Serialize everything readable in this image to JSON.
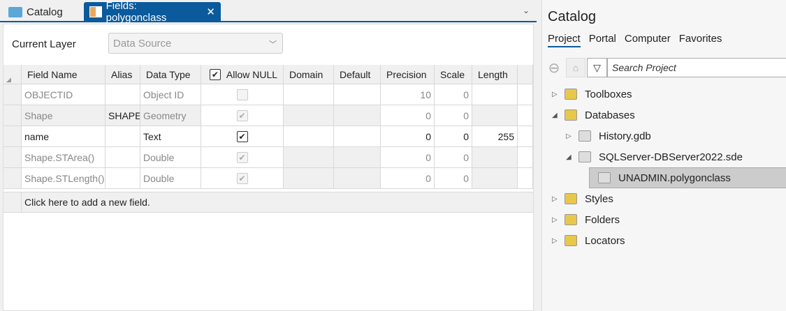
{
  "tabs": {
    "catalog": "Catalog",
    "fields": "Fields: polygonclass",
    "close": "✕",
    "menu": "⌄"
  },
  "current_layer": {
    "label": "Current Layer",
    "value": "Data Source"
  },
  "columns": [
    "Field Name",
    "Alias",
    "Data Type",
    "Allow NULL",
    "Domain",
    "Default",
    "Precision",
    "Scale",
    "Length"
  ],
  "rows": [
    {
      "name": "OBJECTID",
      "alias": "",
      "type": "Object ID",
      "allow_null": false,
      "precision": "10",
      "scale": "0",
      "length": "",
      "readonly": true
    },
    {
      "name": "Shape",
      "alias": "SHAPE",
      "type": "Geometry",
      "allow_null": true,
      "precision": "0",
      "scale": "0",
      "length": "",
      "readonly": true
    },
    {
      "name": "name",
      "alias": "",
      "type": "Text",
      "allow_null": true,
      "precision": "0",
      "scale": "0",
      "length": "255",
      "readonly": false
    },
    {
      "name": "Shape.STArea()",
      "alias": "",
      "type": "Double",
      "allow_null": true,
      "precision": "0",
      "scale": "0",
      "length": "",
      "readonly": true
    },
    {
      "name": "Shape.STLength()",
      "alias": "",
      "type": "Double",
      "allow_null": true,
      "precision": "0",
      "scale": "0",
      "length": "",
      "readonly": true
    }
  ],
  "add_field": "Click here to add a new field.",
  "catalog": {
    "title": "Catalog",
    "tabs": [
      "Project",
      "Portal",
      "Computer",
      "Favorites"
    ],
    "search_placeholder": "Search Project",
    "tree": [
      {
        "label": "Toolboxes",
        "level": 0,
        "toggle": "▷",
        "color": "#e8c84a"
      },
      {
        "label": "Databases",
        "level": 0,
        "toggle": "◢",
        "color": "#e8c84a"
      },
      {
        "label": "History.gdb",
        "level": 1,
        "toggle": "▷",
        "color": "#ddd"
      },
      {
        "label": "SQLServer-DBServer2022.sde",
        "level": 1,
        "toggle": "◢",
        "color": "#ddd"
      },
      {
        "label": "UNADMIN.polygonclass",
        "level": 2,
        "toggle": "",
        "color": "#ddd",
        "selected": true
      },
      {
        "label": "Styles",
        "level": 0,
        "toggle": "▷",
        "color": "#e8c84a"
      },
      {
        "label": "Folders",
        "level": 0,
        "toggle": "▷",
        "color": "#e8c84a"
      },
      {
        "label": "Locators",
        "level": 0,
        "toggle": "▷",
        "color": "#e8c84a"
      }
    ]
  }
}
